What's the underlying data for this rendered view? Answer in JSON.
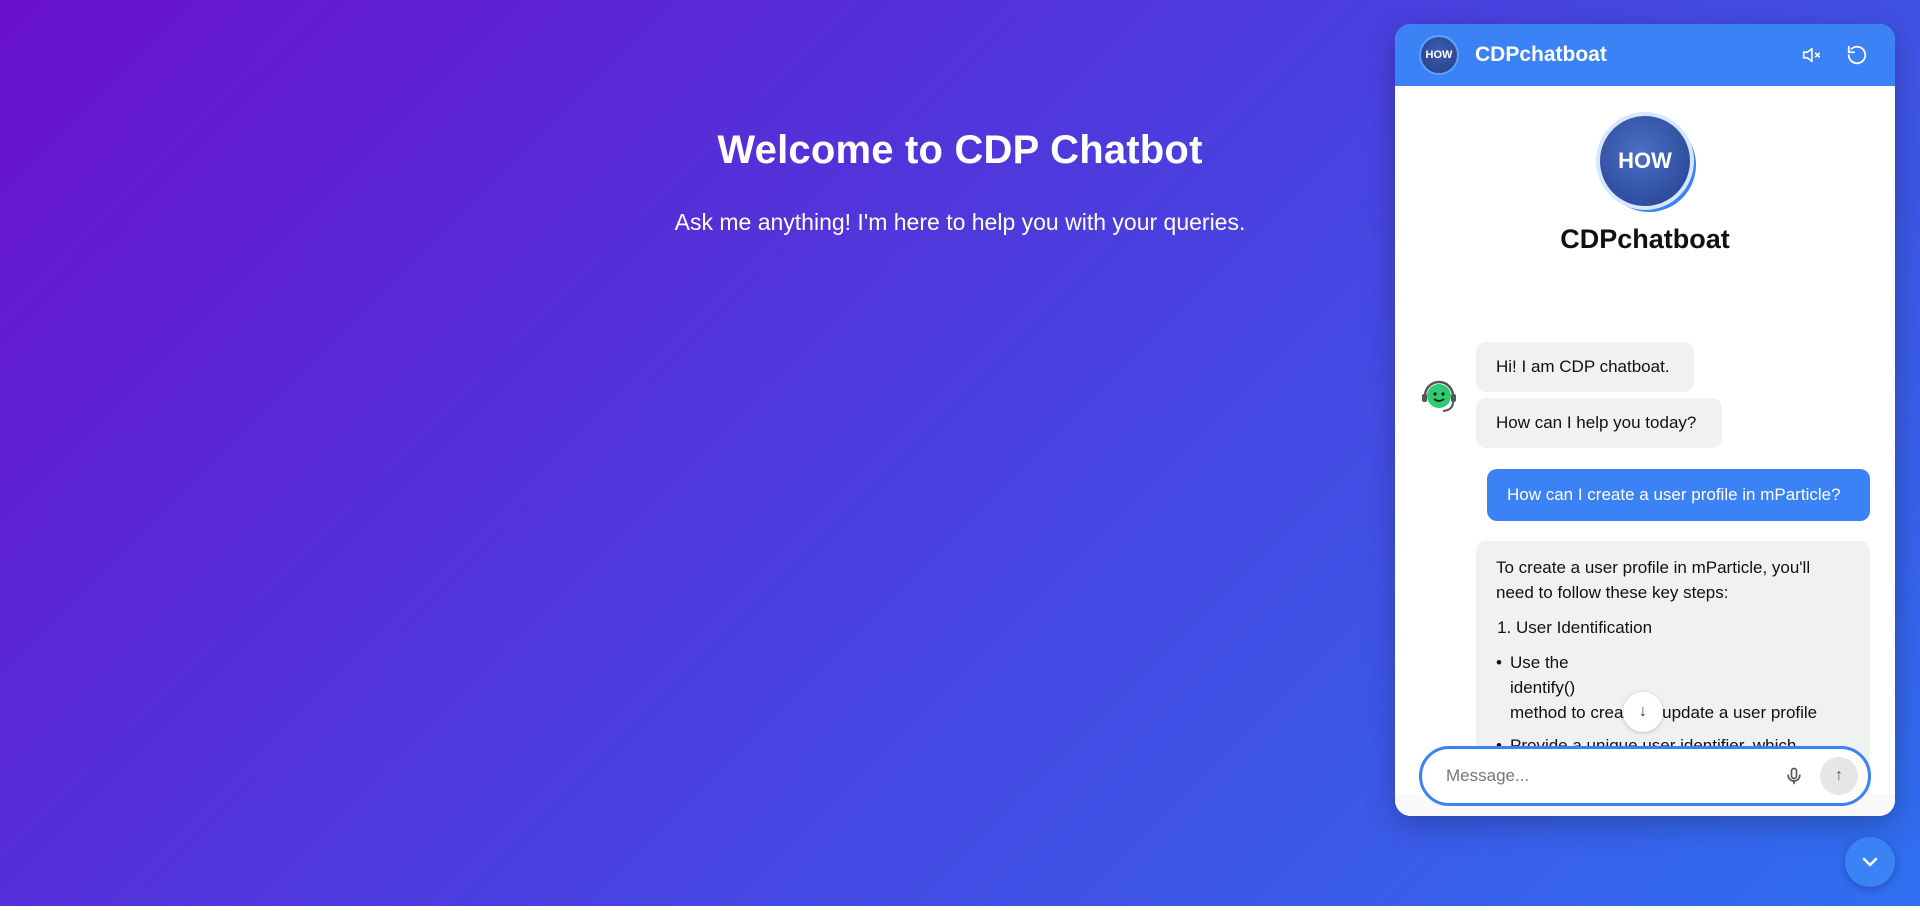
{
  "hero": {
    "title": "Welcome to CDP Chatbot",
    "subtitle": "Ask me anything! I'm here to help you with your queries."
  },
  "widget": {
    "header_title": "CDPchatboat",
    "logo_text": "HOW",
    "profile_name": "CDPchatboat",
    "icons": {
      "mute": "speaker-muted-icon",
      "reset": "refresh-icon",
      "mic": "microphone-icon",
      "send": "arrow-up-icon",
      "scroll": "arrow-down-icon",
      "toggle": "chevron-down-icon"
    },
    "accent_color": "#3a82f6"
  },
  "messages": {
    "bot_greeting_1": "Hi! I am CDP chatboat.",
    "bot_greeting_2": "How can I help you today?",
    "user_question": "How can I create a user profile in mParticle?",
    "answer_intro": "To create a user profile in mParticle, you'll need to follow these key steps:",
    "answer_step_1": "User Identification",
    "bullet_1_line_1": "Use the",
    "bullet_1_line_2": "identify()",
    "bullet_1_line_3": "method to create or update a user profile",
    "bullet_2": "Provide a unique user identifier, which"
  },
  "composer": {
    "placeholder": "Message..."
  }
}
